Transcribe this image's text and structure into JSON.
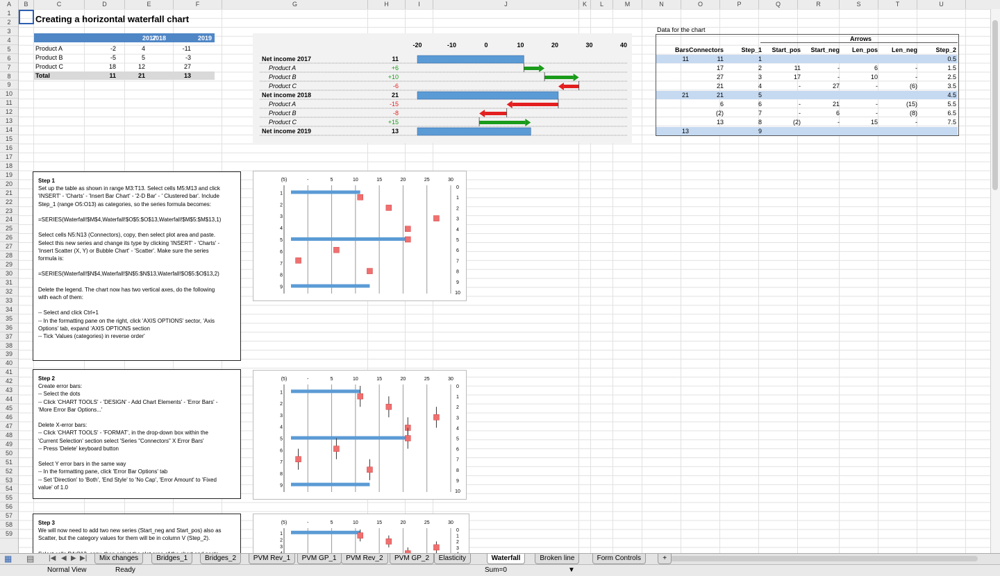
{
  "columns": [
    "A",
    "B",
    "C",
    "D",
    "E",
    "F",
    "G",
    "H",
    "I",
    "J",
    "K",
    "L",
    "M",
    "N",
    "O",
    "P",
    "Q",
    "R",
    "S",
    "T",
    "U"
  ],
  "rows": [
    "1",
    "2",
    "3",
    "4",
    "5",
    "6",
    "7",
    "8",
    "9",
    "10",
    "11",
    "12",
    "13",
    "14",
    "15",
    "16",
    "17",
    "18",
    "19",
    "20",
    "21",
    "22",
    "23",
    "24",
    "25",
    "26",
    "27",
    "28",
    "29",
    "30",
    "31",
    "32",
    "33",
    "34",
    "35",
    "36",
    "37",
    "38",
    "39",
    "40",
    "41",
    "42",
    "43",
    "44",
    "45",
    "46",
    "47",
    "48",
    "49",
    "50",
    "51",
    "52",
    "53",
    "54",
    "55",
    "56",
    "57",
    "58",
    "59"
  ],
  "title": "Creating a horizontal waterfall chart",
  "source_table": {
    "headers": [
      "2017",
      "2018",
      "2019"
    ],
    "rows": [
      {
        "label": "Product A",
        "v": [
          "-2",
          "4",
          "-11"
        ]
      },
      {
        "label": "Product B",
        "v": [
          "-5",
          "5",
          "-3"
        ]
      },
      {
        "label": "Product C",
        "v": [
          "18",
          "12",
          "27"
        ]
      },
      {
        "label": "Total",
        "v": [
          "11",
          "21",
          "13"
        ]
      }
    ]
  },
  "waterfall": {
    "axis_ticks": [
      "-20",
      "-10",
      "0",
      "10",
      "20",
      "30",
      "40"
    ],
    "rows": [
      {
        "label": "Net income 2017",
        "value": "11",
        "kind": "total",
        "start": 0,
        "end": 11
      },
      {
        "label": "Product A",
        "value": "+6",
        "kind": "pos",
        "start": 11,
        "end": 17
      },
      {
        "label": "Product B",
        "value": "+10",
        "kind": "pos",
        "start": 17,
        "end": 27
      },
      {
        "label": "Product C",
        "value": "-6",
        "kind": "neg",
        "start": 27,
        "end": 21
      },
      {
        "label": "Net income 2018",
        "value": "21",
        "kind": "total",
        "start": 0,
        "end": 21
      },
      {
        "label": "Product A",
        "value": "-15",
        "kind": "neg",
        "start": 21,
        "end": 6
      },
      {
        "label": "Product B",
        "value": "-8",
        "kind": "neg",
        "start": 6,
        "end": -2
      },
      {
        "label": "Product C",
        "value": "+15",
        "kind": "pos",
        "start": -2,
        "end": 13
      },
      {
        "label": "Net income 2019",
        "value": "13",
        "kind": "total",
        "start": 0,
        "end": 13
      }
    ]
  },
  "chart_table": {
    "caption": "Data for the chart",
    "group_header": "Arrows",
    "headers": [
      "Bars",
      "Connectors",
      "Step_1",
      "Start_pos",
      "Start_neg",
      "Len_pos",
      "Len_neg",
      "Step_2"
    ],
    "rows": [
      [
        "11",
        "11",
        "1",
        "",
        "",
        "",
        "",
        "0.5"
      ],
      [
        "",
        "17",
        "2",
        "11",
        "-",
        "6",
        "-",
        "1.5"
      ],
      [
        "",
        "27",
        "3",
        "17",
        "-",
        "10",
        "-",
        "2.5"
      ],
      [
        "",
        "21",
        "4",
        "-",
        "27",
        "-",
        "(6)",
        "3.5"
      ],
      [
        "21",
        "21",
        "5",
        "",
        "",
        "",
        "",
        "4.5"
      ],
      [
        "",
        "6",
        "6",
        "-",
        "21",
        "-",
        "(15)",
        "5.5"
      ],
      [
        "",
        "(2)",
        "7",
        "-",
        "6",
        "-",
        "(8)",
        "6.5"
      ],
      [
        "",
        "13",
        "8",
        "(2)",
        "-",
        "15",
        "-",
        "7.5"
      ],
      [
        "13",
        "",
        "9",
        "",
        "",
        "",
        "",
        ""
      ]
    ]
  },
  "steps": [
    {
      "lines": [
        "Step 1",
        "Set up the table as shown in range M3:T13. Select cells M5:M13 and click",
        "'INSERT' - 'Charts' - 'Insert Bar Chart' - '2-D Bar' - ' Clustered bar'. Include",
        "Step_1 (range O5:O13) as categories, so the series formula becomes:",
        "",
        "=SERIES(Waterfall!$M$4,Waterfall!$O$5:$O$13,Waterfall!$M$5:$M$13,1)",
        "",
        "Select cells N5:N13 (Connectors), copy, then select plot area and paste.",
        "Select this new series and change its type by clicking 'INSERT' - 'Charts' -",
        "'Insert Scatter (X, Y) or Bubble Chart' - 'Scatter'. Make sure the series",
        "formula is:",
        "",
        "=SERIES(Waterfall!$N$4,Waterfall!$N$5:$N$13,Waterfall!$O$5:$O$13,2)",
        "",
        "Delete the legend. The chart now has two vertical axes, do the following",
        "with each of them:",
        "",
        "-- Select and click Ctrl+1",
        "-- In the formatting pane on the right, click 'AXIS OPTIONS' sector, 'Axis",
        "Options' tab, expand 'AXIS OPTIONS section",
        "-- Tick 'Values (categories) in reverse order'"
      ]
    },
    {
      "lines": [
        "Step 2",
        "Create error bars:",
        "-- Select the dots",
        "-- Click 'CHART TOOLS' - 'DESIGN' - Add Chart Elements' - 'Error Bars' -",
        "'More Error Bar Options...'",
        "",
        "Delete X-error bars:",
        "-- Click 'CHART TOOLS' - 'FORMAT', in the drop-down box within the",
        "'Current Selection' section select 'Series \"Connectors\" X Error Bars'",
        "-- Press 'Delete' keyboard button",
        "",
        "Select Y error bars in the same way",
        "-- In the formatting pane, click 'Error Bar Options' tab",
        "-- Set 'Direction' to 'Both', 'End Style' to 'No Cap', 'Error Amount' to 'Fixed",
        "value' of 1.0"
      ]
    },
    {
      "lines": [
        "Step 3",
        "We will now need to add two new series (Start_neg and Start_pos) also as",
        "Scatter, but the category values for them will be in column V (Step_2).",
        "",
        "Select cells P4:Q13, copy, then select the plot area of the chart and paste."
      ]
    }
  ],
  "mini_chart": {
    "x_ticks": [
      "(5)",
      "-",
      "5",
      "10",
      "15",
      "20",
      "25",
      "30"
    ],
    "left_ticks": [
      "1",
      "2",
      "3",
      "4",
      "5",
      "6",
      "7",
      "8",
      "9"
    ],
    "right_ticks": [
      "0",
      "1",
      "2",
      "3",
      "4",
      "5",
      "6",
      "7",
      "8",
      "9",
      "10"
    ]
  },
  "tabs": [
    "Mix changes",
    "Bridges_1",
    "Bridges_2",
    "PVM Rev_1",
    "PVM GP_1",
    "PVM Rev_2",
    "PVM GP_2",
    "Elasticity",
    "Waterfall",
    "Broken line",
    "Form Controls",
    "+"
  ],
  "active_tab": "Waterfall",
  "status": {
    "view": "Normal View",
    "state": "Ready",
    "sum": "Sum=0"
  },
  "colors": {
    "bar": "#5b9bd5",
    "pos": "#1a9b1a",
    "neg": "#e31f1f",
    "marker": "#f07070",
    "header": "#4f86c6",
    "highlight": "#c5d9f1"
  }
}
